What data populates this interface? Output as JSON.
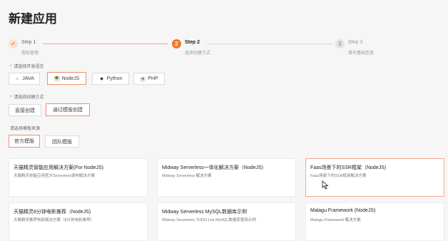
{
  "page": {
    "title": "新建应用"
  },
  "steps": [
    {
      "title": "Step 1",
      "desc": "授权管理",
      "marker": "✓"
    },
    {
      "title": "Step 2",
      "desc": "选择创建方式",
      "marker": "2"
    },
    {
      "title": "Step 3",
      "desc": "填写基础信息",
      "marker": "3"
    }
  ],
  "language": {
    "label": "请选择开发语言",
    "options": [
      {
        "label": "JAVA",
        "icon": "java-icon"
      },
      {
        "label": "NodeJS",
        "icon": "nodejs-icon"
      },
      {
        "label": "Python",
        "icon": "python-icon"
      },
      {
        "label": "PHP",
        "icon": "php-icon"
      }
    ],
    "selected": "NodeJS"
  },
  "create_method": {
    "label": "请选择创建方式",
    "options": [
      {
        "label": "直接创建"
      },
      {
        "label": "通过模版创建"
      }
    ],
    "selected": "通过模版创建"
  },
  "template_source": {
    "label": "请选择模板来源",
    "options": [
      {
        "label": "官方模版"
      },
      {
        "label": "团队模版"
      }
    ],
    "selected": "官方模版"
  },
  "templates": [
    {
      "title": "天猫精灵智能应用解决方案(For NodeJS)",
      "desc": "天猫精灵技能应用官方Serverless架构解决方案"
    },
    {
      "title": "Midway Serverless一体化解决方案（NodeJS)",
      "desc": "Midway Serverless 解决方案"
    },
    {
      "title": "Faas场景下的SSR框架（NodeJS)",
      "desc": "Faas场景下的SSR框架解决方案"
    },
    {
      "title": "天猫精灵8分钟电影推荐（NodeJS)",
      "desc": "天猫精灵推荐电影解决方案（8分钟电影推荐）"
    },
    {
      "title": "Midway Serverless MySQL数据库示例",
      "desc": "Midway Serverless TODO List MySQL数据库使用示例"
    },
    {
      "title": "Malagu Framework (NodeJS)",
      "desc": "Malagu Framework 解决方案"
    }
  ],
  "colors": {
    "accent": "#f0782d",
    "accent_light": "#f4a78a"
  }
}
